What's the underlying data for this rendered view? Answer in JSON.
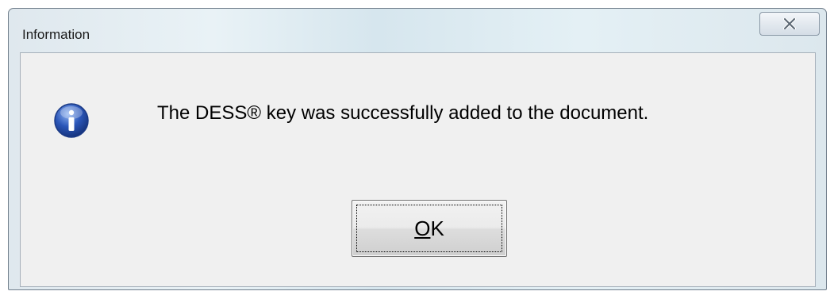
{
  "window": {
    "title": "Information",
    "close_icon": "close-x-icon"
  },
  "dialog": {
    "icon": "info-icon",
    "message": "The DESS® key was successfully added to the document."
  },
  "ok_button": {
    "accel_letter": "O",
    "rest_label": "K"
  },
  "colors": {
    "client_bg": "#f0f0f0",
    "frame_glass": "#dfe8ee",
    "info_blue": "#2b56b8"
  }
}
